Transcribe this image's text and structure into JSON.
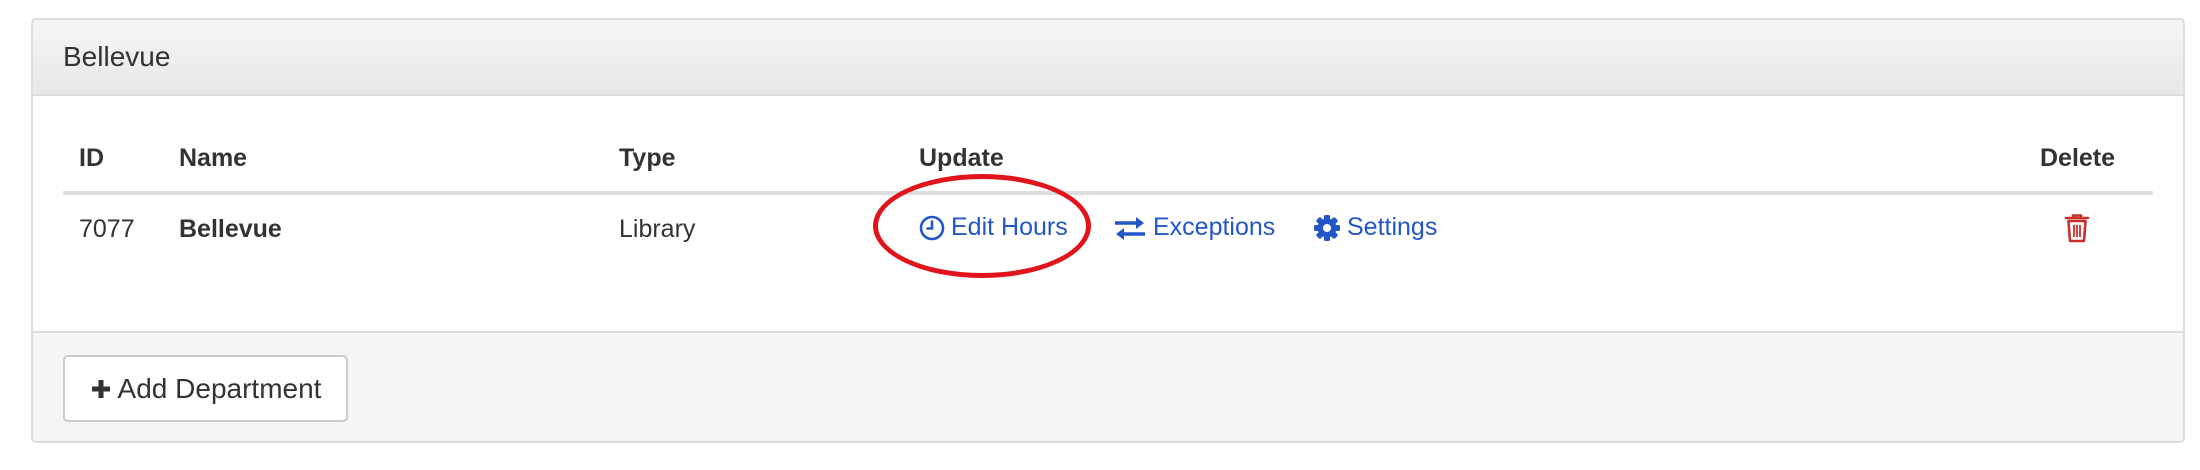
{
  "panel": {
    "title": "Bellevue"
  },
  "table": {
    "headers": {
      "id": "ID",
      "name": "Name",
      "type": "Type",
      "update": "Update",
      "delete": "Delete"
    },
    "rows": [
      {
        "id": "7077",
        "name": "Bellevue",
        "type": "Library",
        "actions": {
          "edit_hours": "Edit Hours",
          "exceptions": "Exceptions",
          "settings": "Settings"
        }
      }
    ]
  },
  "footer": {
    "add_department_label": "Add Department"
  },
  "icons": {
    "edit_hours": "clock-icon",
    "exceptions": "exchange-arrows-icon",
    "settings": "gear-icon",
    "delete": "trash-icon",
    "add": "plus-icon"
  },
  "colors": {
    "link": "#2357c8",
    "delete": "#c9302c",
    "annotation": "#e0141a",
    "heading_bg": "#ececec",
    "footer_bg": "#f5f5f5"
  }
}
